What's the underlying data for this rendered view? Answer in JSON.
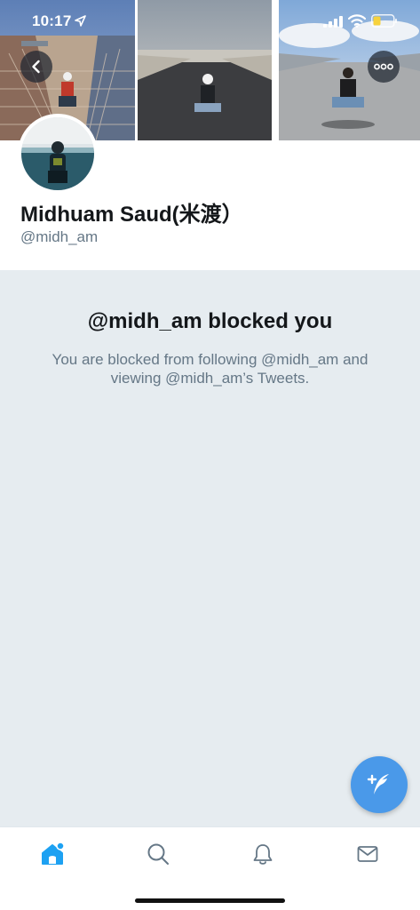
{
  "status_bar": {
    "time": "10:17"
  },
  "header": {
    "back_icon": "chevron-left-icon",
    "more_icon": "ellipsis-icon"
  },
  "profile": {
    "display_name": "Midhuam Saud(米渡）",
    "handle": "@midh_am"
  },
  "blocked": {
    "title": "@midh_am blocked you",
    "message": "You are blocked from following @midh_am and viewing @midh_am’s Tweets."
  },
  "compose": {
    "icon": "compose-tweet-icon"
  },
  "tab_bar": {
    "items": [
      {
        "name": "home",
        "icon": "home-icon",
        "active": true
      },
      {
        "name": "search",
        "icon": "search-icon",
        "active": false
      },
      {
        "name": "notifications",
        "icon": "bell-icon",
        "active": false
      },
      {
        "name": "messages",
        "icon": "mail-icon",
        "active": false
      }
    ]
  },
  "colors": {
    "accent": "#1da1f2",
    "fab": "#4a99e9",
    "blocked_background": "#e6ecf0",
    "secondary_text": "#657786",
    "primary_text": "#14171a"
  }
}
